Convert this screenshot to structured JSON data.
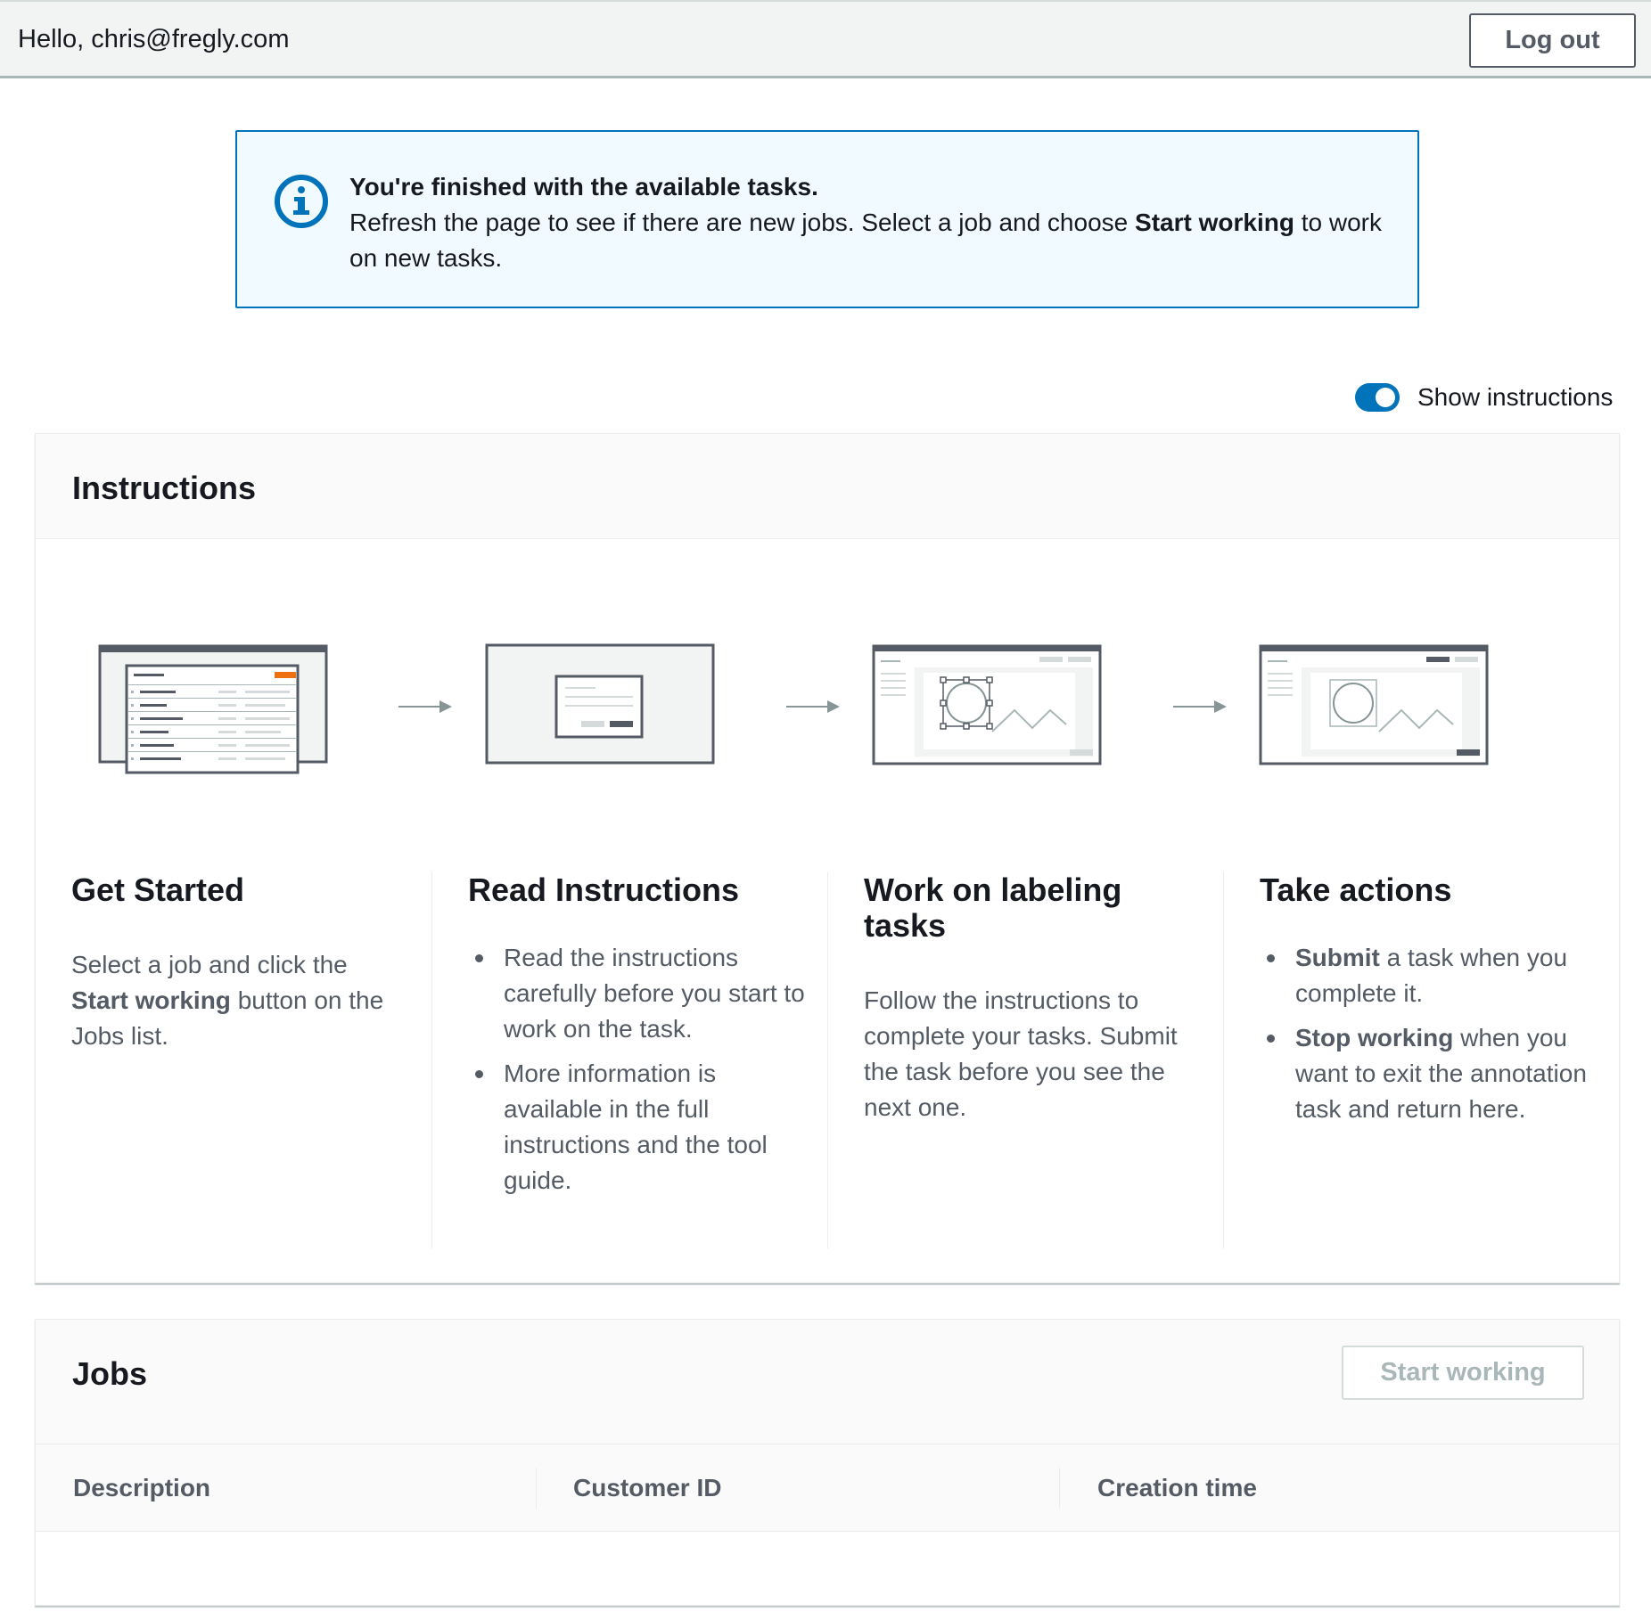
{
  "header": {
    "greeting": "Hello, chris@fregly.com",
    "logout_label": "Log out"
  },
  "alert": {
    "icon": "info-icon",
    "title": "You're finished with the available tasks.",
    "body_before": "Refresh the page to see if there are new jobs. Select a job and choose ",
    "body_bold": "Start working",
    "body_after": " to work on new tasks."
  },
  "toggle": {
    "label": "Show instructions",
    "on": true,
    "color": "#0073bb"
  },
  "instructions": {
    "title": "Instructions",
    "steps": [
      {
        "title": "Get Started",
        "body_before": "Select a job and click the ",
        "body_bold": "Start working",
        "body_after": " button on the Jobs list."
      },
      {
        "title": "Read Instructions",
        "bullets": [
          "Read the instructions carefully before you start to work on the task.",
          "More information is available in the full instructions and the tool guide."
        ]
      },
      {
        "title": "Work on labeling tasks",
        "body": "Follow the instructions to complete your tasks. Submit the task before you see the next one."
      },
      {
        "title": "Take actions",
        "bullets": [
          {
            "bold": "Submit",
            "rest": " a task when you complete it."
          },
          {
            "bold": "Stop working",
            "rest": " when you want to exit the annotation task and return here."
          }
        ]
      }
    ]
  },
  "jobs": {
    "title": "Jobs",
    "start_label": "Start working",
    "columns": [
      "Description",
      "Customer ID",
      "Creation time"
    ]
  },
  "colors": {
    "accent": "#0073bb",
    "illustration_accent": "#ec7211"
  }
}
